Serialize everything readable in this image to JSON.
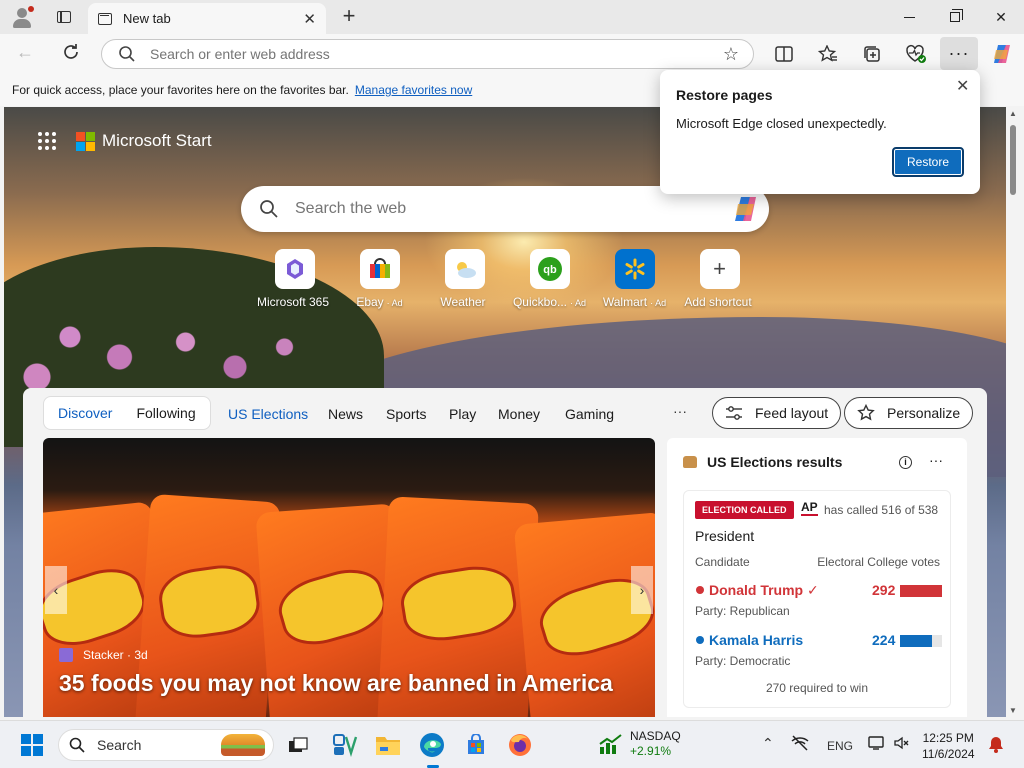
{
  "window": {
    "tab_title": "New tab",
    "new_tab_label": "+"
  },
  "toolbar": {
    "address_placeholder": "Search or enter web address"
  },
  "favbar": {
    "message": "For quick access, place your favorites here on the favorites bar.",
    "link": "Manage favorites now"
  },
  "restore": {
    "title": "Restore pages",
    "message": "Microsoft Edge closed unexpectedly.",
    "button": "Restore"
  },
  "start": {
    "brand": "Microsoft Start",
    "search_placeholder": "Search the web",
    "shortcuts": [
      {
        "label": "Microsoft 365",
        "ad": ""
      },
      {
        "label": "Ebay",
        "ad": "· Ad"
      },
      {
        "label": "Weather",
        "ad": ""
      },
      {
        "label": "Quickbo...",
        "ad": "· Ad"
      },
      {
        "label": "Walmart",
        "ad": "· Ad"
      },
      {
        "label": "Add shortcut",
        "ad": ""
      }
    ]
  },
  "feed": {
    "pivot": [
      "Discover",
      "Following"
    ],
    "nav": [
      "US Elections",
      "News",
      "Sports",
      "Play",
      "Money",
      "Gaming"
    ],
    "more": "···",
    "feed_layout": "Feed layout",
    "personalize": "Personalize",
    "hero": {
      "source": "Stacker · 3d",
      "title": "35 foods you may not know are banned in America"
    }
  },
  "election": {
    "title": "US Elections results",
    "more": "···",
    "badge": "ELECTION CALLED",
    "ap": "AP",
    "called": "has called 516 of 538",
    "race": "President",
    "col_left": "Candidate",
    "col_right": "Electoral College votes",
    "candidates": [
      {
        "name": "Donald Trump ✓",
        "party": "Party: Republican",
        "votes": "292",
        "color": "#d13438",
        "share": 1.0
      },
      {
        "name": "Kamala Harris",
        "party": "Party: Democratic",
        "votes": "224",
        "color": "#0f6cbd",
        "share": 0.77
      }
    ],
    "footer": "270 required to win"
  },
  "taskbar": {
    "search_label": "Search",
    "stock_name": "NASDAQ",
    "stock_change": "+2.91%",
    "lang": "ENG",
    "time": "12:25 PM",
    "date": "11/6/2024"
  },
  "colors": {
    "accent": "#0f6cbd",
    "link": "#0f5fc0",
    "republican": "#d13438",
    "democratic": "#0f6cbd"
  }
}
